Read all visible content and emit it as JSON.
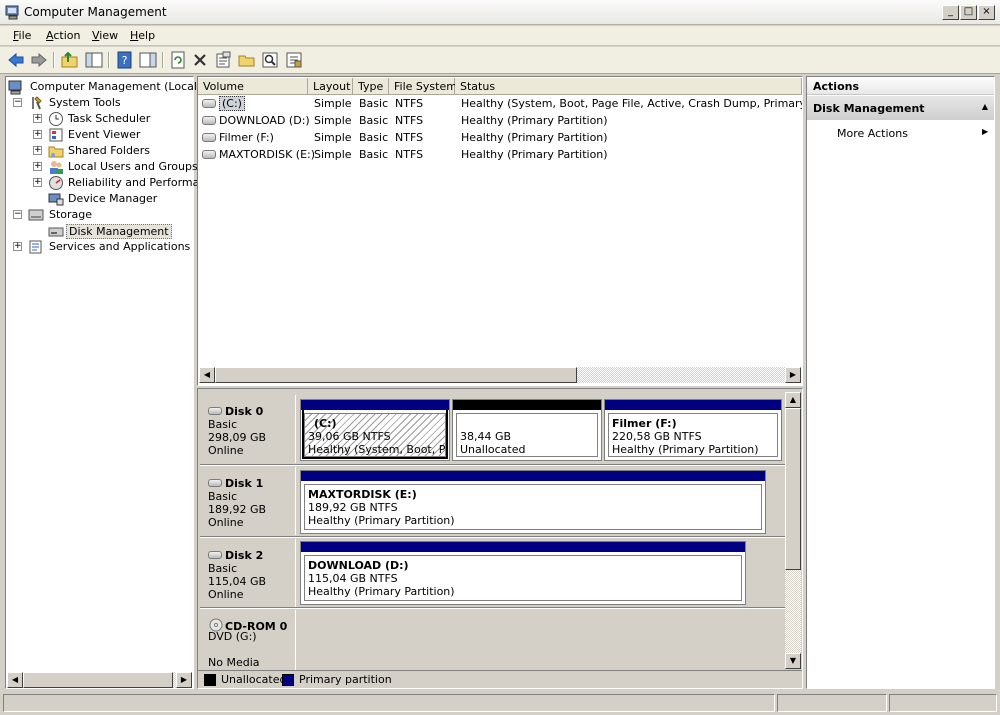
{
  "window": {
    "title": "Computer Management",
    "caption_buttons": [
      "_",
      "□",
      "×"
    ]
  },
  "menu": [
    {
      "label": "File",
      "accel": "F",
      "rest": "ile"
    },
    {
      "label": "Action",
      "accel": "A",
      "rest": "ction"
    },
    {
      "label": "View",
      "accel": "V",
      "rest": "iew"
    },
    {
      "label": "Help",
      "accel": "H",
      "rest": "elp"
    }
  ],
  "toolbar": {
    "buttons": [
      "back-icon",
      "forward-icon",
      "up-folder-icon",
      "show-hide-tree-icon",
      "help-icon",
      "show-hide-action-icon",
      "refresh-icon",
      "delete-icon",
      "properties-icon",
      "open-icon",
      "search-icon",
      "export-icon"
    ]
  },
  "tree": {
    "root": "Computer Management (Local)",
    "system_tools": "System Tools",
    "task_scheduler": "Task Scheduler",
    "event_viewer": "Event Viewer",
    "shared_folders": "Shared Folders",
    "local_users": "Local Users and Groups",
    "reliability": "Reliability and Performanc",
    "device_manager": "Device Manager",
    "storage": "Storage",
    "disk_management": "Disk Management",
    "services": "Services and Applications",
    "expand_plus": "+",
    "collapse_minus": "−"
  },
  "volume_list": {
    "headers": [
      "Volume",
      "Layout",
      "Type",
      "File System",
      "Status"
    ],
    "rows": [
      {
        "volume": "(C:)",
        "layout": "Simple",
        "type": "Basic",
        "fs": "NTFS",
        "status": "Healthy (System, Boot, Page File, Active, Crash Dump, Primary Partitio"
      },
      {
        "volume": "DOWNLOAD (D:)",
        "layout": "Simple",
        "type": "Basic",
        "fs": "NTFS",
        "status": "Healthy (Primary Partition)"
      },
      {
        "volume": "Filmer (F:)",
        "layout": "Simple",
        "type": "Basic",
        "fs": "NTFS",
        "status": "Healthy (Primary Partition)"
      },
      {
        "volume": "MAXTORDISK (E:)",
        "layout": "Simple",
        "type": "Basic",
        "fs": "NTFS",
        "status": "Healthy (Primary Partition)"
      }
    ]
  },
  "disks": {
    "disk0": {
      "name": "Disk 0",
      "type": "Basic",
      "size": "298,09 GB",
      "state": "Online"
    },
    "disk1": {
      "name": "Disk 1",
      "type": "Basic",
      "size": "189,92 GB",
      "state": "Online"
    },
    "disk2": {
      "name": "Disk 2",
      "type": "Basic",
      "size": "115,04 GB",
      "state": "Online"
    },
    "cdrom0": {
      "name": "CD-ROM 0",
      "type": "DVD (G:)",
      "state": "No Media"
    }
  },
  "partitions": {
    "c": {
      "title": "(C:)",
      "size": "39,06 GB NTFS",
      "status": "Healthy (System, Boot, Page"
    },
    "unalloc": {
      "size": "38,44 GB",
      "status": "Unallocated"
    },
    "f": {
      "title": "Filmer  (F:)",
      "size": "220,58 GB NTFS",
      "status": "Healthy (Primary Partition)"
    },
    "e": {
      "title": "MAXTORDISK  (E:)",
      "size": "189,92 GB NTFS",
      "status": "Healthy (Primary Partition)"
    },
    "d": {
      "title": "DOWNLOAD  (D:)",
      "size": "115,04 GB NTFS",
      "status": "Healthy (Primary Partition)"
    }
  },
  "legend": {
    "unallocated": "Unallocated",
    "primary": "Primary partition",
    "unallocated_color": "#000000",
    "primary_color": "#000080"
  },
  "actions": {
    "header": "Actions",
    "section": "Disk Management",
    "item": "More Actions"
  }
}
